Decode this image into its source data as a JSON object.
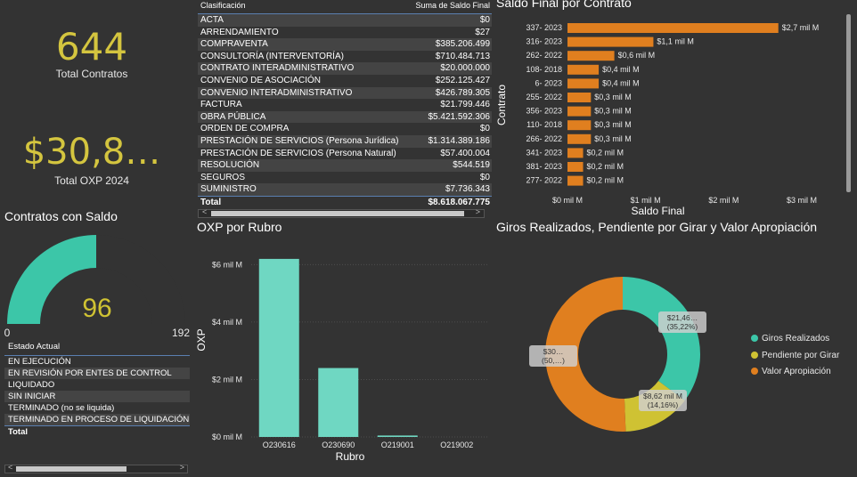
{
  "kpis": {
    "total_contratos": {
      "value": "644",
      "label": "Total Contratos"
    },
    "total_oxp": {
      "value": "$30,8…",
      "label": "Total OXP 2024"
    }
  },
  "table": {
    "col1": "Clasificación",
    "col2": "Suma de Saldo Final",
    "rows": [
      {
        "name": "ACTA",
        "value": "$0"
      },
      {
        "name": "ARRENDAMIENTO",
        "value": "$27"
      },
      {
        "name": "COMPRAVENTA",
        "value": "$385.206.499"
      },
      {
        "name": "CONSULTORÍA (INTERVENTORÍA)",
        "value": "$710.484.713"
      },
      {
        "name": "CONTRATO INTERADMINISTRATIVO",
        "value": "$20.000.000"
      },
      {
        "name": "CONVENIO DE ASOCIACIÓN",
        "value": "$252.125.427"
      },
      {
        "name": "CONVENIO INTERADMINISTRATIVO",
        "value": "$426.789.305"
      },
      {
        "name": "FACTURA",
        "value": "$21.799.446"
      },
      {
        "name": "OBRA PÚBLICA",
        "value": "$5.421.592.306"
      },
      {
        "name": "ORDEN DE COMPRA",
        "value": "$0"
      },
      {
        "name": "PRESTACIÓN DE SERVICIOS (Persona Jurídica)",
        "value": "$1.314.389.186"
      },
      {
        "name": "PRESTACIÓN DE SERVICIOS (Persona Natural)",
        "value": "$57.400.004"
      },
      {
        "name": "RESOLUCIÓN",
        "value": "$544.519"
      },
      {
        "name": "SEGUROS",
        "value": "$0"
      },
      {
        "name": "SUMINISTRO",
        "value": "$7.736.343"
      }
    ],
    "total_label": "Total",
    "total_value": "$8.618.067.775"
  },
  "gauge": {
    "title": "Contratos con Saldo",
    "value": "96",
    "min": "0",
    "max": "192",
    "fraction": 0.5
  },
  "estado": {
    "header": "Estado Actual",
    "items": [
      "EN EJECUCIÓN",
      "EN REVISIÓN POR ENTES DE CONTROL",
      "LIQUIDADO",
      "SIN INICIAR",
      "TERMINADO (no se liquida)",
      "TERMINADO EN PROCESO DE LIQUIDACIÓN"
    ],
    "total": "Total"
  },
  "chart_data": [
    {
      "type": "bar",
      "orientation": "horizontal",
      "title": "Saldo Final por Contrato",
      "xlabel": "Saldo Final",
      "ylabel": "Contrato",
      "categories": [
        "337- 2023",
        "316- 2023",
        "262- 2022",
        "108- 2018",
        "6- 2023",
        "255- 2022",
        "356- 2023",
        "110- 2018",
        "266- 2022",
        "341- 2023",
        "381- 2023",
        "277- 2022"
      ],
      "values": [
        2.7,
        1.1,
        0.6,
        0.4,
        0.4,
        0.3,
        0.3,
        0.3,
        0.3,
        0.2,
        0.2,
        0.2
      ],
      "data_labels": [
        "$2,7 mil M",
        "$1,1 mil M",
        "$0,6 mil M",
        "$0,4 mil M",
        "$0,4 mil M",
        "$0,3 mil M",
        "$0,3 mil M",
        "$0,3 mil M",
        "$0,3 mil M",
        "$0,2 mil M",
        "$0,2 mil M",
        "$0,2 mil M"
      ],
      "xticks": [
        "$0 mil M",
        "$1 mil M",
        "$2 mil M",
        "$3 mil M"
      ],
      "xlim": [
        0,
        3
      ],
      "color": "#e07f1f"
    },
    {
      "type": "bar",
      "title": "OXP por Rubro",
      "xlabel": "Rubro",
      "ylabel": "OXP",
      "categories": [
        "O230616",
        "O230690",
        "O219001",
        "O219002"
      ],
      "values": [
        6.2,
        2.4,
        0.05,
        0
      ],
      "yticks": [
        "$0 mil M",
        "$2 mil M",
        "$4 mil M",
        "$6 mil M"
      ],
      "ylim": [
        0,
        6.6
      ],
      "color": "#6fd7c2"
    },
    {
      "type": "pie",
      "title": "Giros Realizados, Pendiente por Girar y Valor Apropiación",
      "categories": [
        "Giros Realizados",
        "Pendiente por Girar",
        "Valor Apropiación"
      ],
      "values": [
        35.22,
        14.16,
        50.62
      ],
      "data_labels": [
        "$21,46… (35,22%)",
        "$8,62 mil M (14,16%)",
        "$30… (50,…)"
      ],
      "colors": [
        "#3cc6a8",
        "#cfc233",
        "#e07f1f"
      ],
      "legend": "right"
    }
  ]
}
